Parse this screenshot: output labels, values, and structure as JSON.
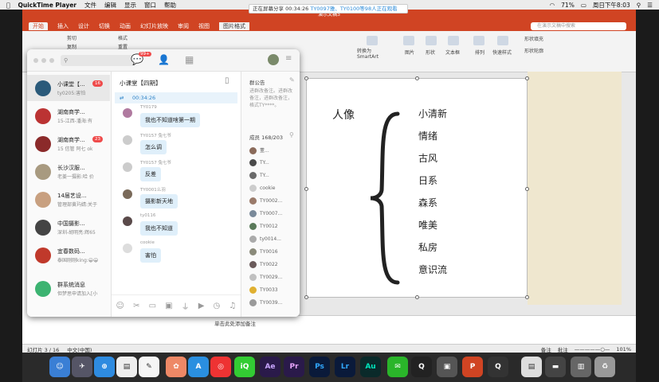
{
  "menubar": {
    "app": "QuickTime Player",
    "items": [
      "文件",
      "编辑",
      "显示",
      "窗口",
      "帮助"
    ],
    "battery": "71%",
    "clock": "周日下午8:03"
  },
  "screen_share": {
    "prefix": "正在屏幕分享 00:34:26",
    "highlight": "TY0097雅、TY0100等98人正在观看"
  },
  "ppt": {
    "title_fragment": "演示文稿3",
    "tabs": [
      "开始",
      "插入",
      "设计",
      "切换",
      "动画",
      "幻灯片放映",
      "审阅",
      "视图",
      "图片格式"
    ],
    "search_placeholder": "在演示文稿中搜索",
    "ribbon": {
      "cut": "剪切",
      "copy": "复制",
      "paste_format": "格式",
      "reset": "重置",
      "smartart": "转换为SmartArt",
      "picture": "图片",
      "shape": "形状",
      "textbox": "文本框",
      "arrange": "排列",
      "quick_style": "快速样式",
      "fill": "形状填充",
      "outline": "形状轮廓"
    },
    "slide": {
      "title": "人像",
      "items": [
        "小清新",
        "情绪",
        "古风",
        "日系",
        "森系",
        "唯美",
        "私房",
        "意识流"
      ]
    },
    "notes_placeholder": "单击此处添加备注",
    "status": {
      "slide": "幻灯片 3 / 16",
      "lang": "中文(中国)",
      "notes": "备注",
      "comments": "批注",
      "zoom": "101%"
    }
  },
  "qq": {
    "search_icon": "search-icon",
    "badge": "99+",
    "chats": [
      {
        "name": "小课堂【...",
        "preview": "ty0205:害怕",
        "badge": "16"
      },
      {
        "name": "湖南商学...",
        "preview": "15-江西-潘海:有",
        "badge": ""
      },
      {
        "name": "湖南商学...",
        "preview": "15 信管 阿七 ok",
        "badge": "23"
      },
      {
        "name": "长沙汉服...",
        "preview": "老姜一摄影:哈 价",
        "badge": ""
      },
      {
        "name": "14届艺设...",
        "preview": "管理部黄玙婧:关于",
        "badge": ""
      },
      {
        "name": "中国摄影...",
        "preview": "深圳-胡明亮:辉65",
        "badge": ""
      },
      {
        "name": "宜春数码...",
        "preview": "泰国刚刚king:😀😀",
        "badge": ""
      },
      {
        "name": "群系统消息",
        "preview": "但梦思申请加入[小",
        "badge": ""
      }
    ],
    "chat_title": "小课堂【四期】",
    "share_time": "00:34:26",
    "messages": [
      {
        "sender": "TY0179",
        "text": "我也不知道啥第一期"
      },
      {
        "sender": "TY0157 兔七爷",
        "text": "怎么调"
      },
      {
        "sender": "TY0157 兔七爷",
        "text": "反差"
      },
      {
        "sender": "TY0001么羽",
        "text": "摄影新天地"
      },
      {
        "sender": "ty0116",
        "text": "我也不知道"
      },
      {
        "sender": "cookie",
        "text": "害怕"
      }
    ],
    "group": {
      "announcement_title": "群公告",
      "announcement_text": "进群改备注。进群改备注，进群改备注，格式TY****。",
      "members_title": "成员 168/203",
      "members": [
        "董...",
        "TY...",
        "TY...",
        "cookie",
        "TY0002...",
        "TY0007...",
        "TY0012",
        "ty0014...",
        "TY0016",
        "TY0022",
        "TY0029...",
        "TY0033",
        "TY0039..."
      ]
    }
  },
  "dock_apps": [
    "Finder",
    "Launchpad",
    "Safari",
    "Calendar",
    "Photos",
    "App Store",
    "NetEase",
    "iQIYI",
    "Ae",
    "Pr",
    "Ps",
    "Lr",
    "Au",
    "WeChat",
    "QQ",
    "PowerPoint",
    "QuickTime",
    "Preview",
    "Trash"
  ]
}
